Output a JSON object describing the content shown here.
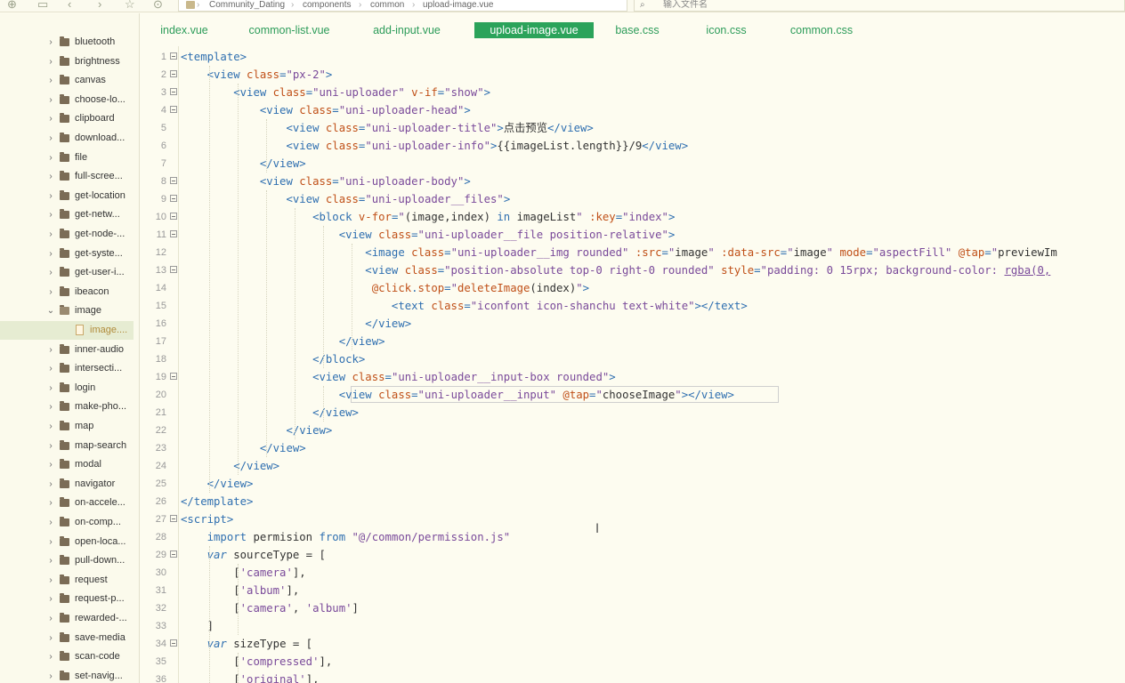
{
  "toolbar": {
    "icons": [
      "new-file-icon",
      "save-icon",
      "back-icon",
      "forward-icon",
      "star-icon",
      "run-icon"
    ],
    "breadcrumb": [
      "Community_Dating",
      "components",
      "common",
      "upload-image.vue"
    ],
    "search_placeholder": "输入文件名"
  },
  "sidebar": {
    "items": [
      {
        "label": "bluetooth",
        "type": "folder",
        "expanded": false
      },
      {
        "label": "brightness",
        "type": "folder",
        "expanded": false
      },
      {
        "label": "canvas",
        "type": "folder",
        "expanded": false
      },
      {
        "label": "choose-lo...",
        "type": "folder",
        "expanded": false
      },
      {
        "label": "clipboard",
        "type": "folder",
        "expanded": false
      },
      {
        "label": "download...",
        "type": "folder",
        "expanded": false
      },
      {
        "label": "file",
        "type": "folder",
        "expanded": false
      },
      {
        "label": "full-scree...",
        "type": "folder",
        "expanded": false
      },
      {
        "label": "get-location",
        "type": "folder",
        "expanded": false
      },
      {
        "label": "get-netw...",
        "type": "folder",
        "expanded": false
      },
      {
        "label": "get-node-...",
        "type": "folder",
        "expanded": false
      },
      {
        "label": "get-syste...",
        "type": "folder",
        "expanded": false
      },
      {
        "label": "get-user-i...",
        "type": "folder",
        "expanded": false
      },
      {
        "label": "ibeacon",
        "type": "folder",
        "expanded": false
      },
      {
        "label": "image",
        "type": "folder",
        "expanded": true
      },
      {
        "label": "image....",
        "type": "file",
        "selected": true
      },
      {
        "label": "inner-audio",
        "type": "folder",
        "expanded": false
      },
      {
        "label": "intersecti...",
        "type": "folder",
        "expanded": false
      },
      {
        "label": "login",
        "type": "folder",
        "expanded": false
      },
      {
        "label": "make-pho...",
        "type": "folder",
        "expanded": false
      },
      {
        "label": "map",
        "type": "folder",
        "expanded": false
      },
      {
        "label": "map-search",
        "type": "folder",
        "expanded": false
      },
      {
        "label": "modal",
        "type": "folder",
        "expanded": false
      },
      {
        "label": "navigator",
        "type": "folder",
        "expanded": false
      },
      {
        "label": "on-accele...",
        "type": "folder",
        "expanded": false
      },
      {
        "label": "on-comp...",
        "type": "folder",
        "expanded": false
      },
      {
        "label": "open-loca...",
        "type": "folder",
        "expanded": false
      },
      {
        "label": "pull-down...",
        "type": "folder",
        "expanded": false
      },
      {
        "label": "request",
        "type": "folder",
        "expanded": false
      },
      {
        "label": "request-p...",
        "type": "folder",
        "expanded": false
      },
      {
        "label": "rewarded-...",
        "type": "folder",
        "expanded": false
      },
      {
        "label": "save-media",
        "type": "folder",
        "expanded": false
      },
      {
        "label": "scan-code",
        "type": "folder",
        "expanded": false
      },
      {
        "label": "set-navig...",
        "type": "folder",
        "expanded": false
      }
    ]
  },
  "tabs": [
    {
      "label": "index.vue",
      "active": false
    },
    {
      "label": "common-list.vue",
      "active": false
    },
    {
      "label": "add-input.vue",
      "active": false
    },
    {
      "label": "upload-image.vue",
      "active": true
    },
    {
      "label": "base.css",
      "active": false
    },
    {
      "label": "icon.css",
      "active": false
    },
    {
      "label": "common.css",
      "active": false
    }
  ],
  "colors": {
    "tag": "#2f6fb0",
    "attr": "#c05018",
    "string": "#7a4a9a",
    "text": "#333333",
    "keyword": "#2f6fb0",
    "punct": "#2f6fb0",
    "accent": "#2ba35a"
  },
  "code_lines": [
    {
      "n": "1",
      "fold": true,
      "tokens": [
        [
          "tag",
          "<template>"
        ]
      ]
    },
    {
      "n": "2",
      "fold": true,
      "tokens": [
        [
          "text",
          "    "
        ],
        [
          "tag",
          "<view "
        ],
        [
          "attr",
          "class"
        ],
        [
          "punct",
          "="
        ],
        [
          "string",
          "\"px-2\""
        ],
        [
          "tag",
          ">"
        ]
      ]
    },
    {
      "n": "3",
      "fold": true,
      "tokens": [
        [
          "text",
          "        "
        ],
        [
          "tag",
          "<view "
        ],
        [
          "attr",
          "class"
        ],
        [
          "punct",
          "="
        ],
        [
          "string",
          "\"uni-uploader\" "
        ],
        [
          "attr",
          "v-if"
        ],
        [
          "punct",
          "="
        ],
        [
          "string",
          "\"show\""
        ],
        [
          "tag",
          ">"
        ]
      ]
    },
    {
      "n": "4",
      "fold": true,
      "tokens": [
        [
          "text",
          "            "
        ],
        [
          "tag",
          "<view "
        ],
        [
          "attr",
          "class"
        ],
        [
          "punct",
          "="
        ],
        [
          "string",
          "\"uni-uploader-head\""
        ],
        [
          "tag",
          ">"
        ]
      ]
    },
    {
      "n": "5",
      "fold": false,
      "tokens": [
        [
          "text",
          "                "
        ],
        [
          "tag",
          "<view "
        ],
        [
          "attr",
          "class"
        ],
        [
          "punct",
          "="
        ],
        [
          "string",
          "\"uni-uploader-title\""
        ],
        [
          "tag",
          ">"
        ],
        [
          "text",
          "点击预览"
        ],
        [
          "tag",
          "</view>"
        ]
      ]
    },
    {
      "n": "6",
      "fold": false,
      "tokens": [
        [
          "text",
          "                "
        ],
        [
          "tag",
          "<view "
        ],
        [
          "attr",
          "class"
        ],
        [
          "punct",
          "="
        ],
        [
          "string",
          "\"uni-uploader-info\""
        ],
        [
          "tag",
          ">"
        ],
        [
          "text",
          "{{imageList.length}}/9"
        ],
        [
          "tag",
          "</view>"
        ]
      ]
    },
    {
      "n": "7",
      "fold": false,
      "tokens": [
        [
          "text",
          "            "
        ],
        [
          "tag",
          "</view>"
        ]
      ]
    },
    {
      "n": "8",
      "fold": true,
      "tokens": [
        [
          "text",
          "            "
        ],
        [
          "tag",
          "<view "
        ],
        [
          "attr",
          "class"
        ],
        [
          "punct",
          "="
        ],
        [
          "string",
          "\"uni-uploader-body\""
        ],
        [
          "tag",
          ">"
        ]
      ]
    },
    {
      "n": "9",
      "fold": true,
      "tokens": [
        [
          "text",
          "                "
        ],
        [
          "tag",
          "<view "
        ],
        [
          "attr",
          "class"
        ],
        [
          "punct",
          "="
        ],
        [
          "string",
          "\"uni-uploader__files\""
        ],
        [
          "tag",
          ">"
        ]
      ]
    },
    {
      "n": "10",
      "fold": true,
      "tokens": [
        [
          "text",
          "                    "
        ],
        [
          "tag",
          "<block "
        ],
        [
          "attr",
          "v-for"
        ],
        [
          "punct",
          "="
        ],
        [
          "string",
          "\""
        ],
        [
          "text",
          "(image,index) "
        ],
        [
          "tag",
          "in "
        ],
        [
          "text",
          "imageList"
        ],
        [
          "string",
          "\" "
        ],
        [
          "attr",
          ":key"
        ],
        [
          "punct",
          "="
        ],
        [
          "string",
          "\"index\""
        ],
        [
          "tag",
          ">"
        ]
      ]
    },
    {
      "n": "11",
      "fold": true,
      "tokens": [
        [
          "text",
          "                        "
        ],
        [
          "tag",
          "<view "
        ],
        [
          "attr",
          "class"
        ],
        [
          "punct",
          "="
        ],
        [
          "string",
          "\"uni-uploader__file position-relative\""
        ],
        [
          "tag",
          ">"
        ]
      ]
    },
    {
      "n": "12",
      "fold": false,
      "tokens": [
        [
          "text",
          "                            "
        ],
        [
          "tag",
          "<image "
        ],
        [
          "attr",
          "class"
        ],
        [
          "punct",
          "="
        ],
        [
          "string",
          "\"uni-uploader__img rounded\" "
        ],
        [
          "attr",
          ":src"
        ],
        [
          "punct",
          "="
        ],
        [
          "string",
          "\""
        ],
        [
          "text",
          "image"
        ],
        [
          "string",
          "\" "
        ],
        [
          "attr",
          ":data-src"
        ],
        [
          "punct",
          "="
        ],
        [
          "string",
          "\""
        ],
        [
          "text",
          "image"
        ],
        [
          "string",
          "\" "
        ],
        [
          "attr",
          "mode"
        ],
        [
          "punct",
          "="
        ],
        [
          "string",
          "\"aspectFill\" "
        ],
        [
          "attr",
          "@tap"
        ],
        [
          "punct",
          "="
        ],
        [
          "string",
          "\""
        ],
        [
          "text",
          "previewIm"
        ]
      ]
    },
    {
      "n": "13",
      "fold": true,
      "tokens": [
        [
          "text",
          "                            "
        ],
        [
          "tag",
          "<view "
        ],
        [
          "attr",
          "class"
        ],
        [
          "punct",
          "="
        ],
        [
          "string",
          "\"position-absolute top-0 right-0 rounded\" "
        ],
        [
          "attr",
          "style"
        ],
        [
          "punct",
          "="
        ],
        [
          "string",
          "\"padding: 0 15rpx; background-color: "
        ],
        [
          "ul",
          "rgba(0,"
        ]
      ]
    },
    {
      "n": "14",
      "fold": false,
      "tokens": [
        [
          "text",
          "                             "
        ],
        [
          "attr",
          "@click"
        ],
        [
          "punct",
          "."
        ],
        [
          "attr",
          "stop"
        ],
        [
          "punct",
          "="
        ],
        [
          "string",
          "\""
        ],
        [
          "attr",
          "deleteImage"
        ],
        [
          "text",
          "(index)"
        ],
        [
          "string",
          "\""
        ],
        [
          "tag",
          ">"
        ]
      ]
    },
    {
      "n": "15",
      "fold": false,
      "tokens": [
        [
          "text",
          "                                "
        ],
        [
          "tag",
          "<text "
        ],
        [
          "attr",
          "class"
        ],
        [
          "punct",
          "="
        ],
        [
          "string",
          "\"iconfont icon-shanchu text-white\""
        ],
        [
          "tag",
          "></text>"
        ]
      ]
    },
    {
      "n": "16",
      "fold": false,
      "tokens": [
        [
          "text",
          "                            "
        ],
        [
          "tag",
          "</view>"
        ]
      ]
    },
    {
      "n": "17",
      "fold": false,
      "tokens": [
        [
          "text",
          "                        "
        ],
        [
          "tag",
          "</view>"
        ]
      ]
    },
    {
      "n": "18",
      "fold": false,
      "tokens": [
        [
          "text",
          "                    "
        ],
        [
          "tag",
          "</block>"
        ]
      ]
    },
    {
      "n": "19",
      "fold": true,
      "tokens": [
        [
          "text",
          "                    "
        ],
        [
          "tag",
          "<view "
        ],
        [
          "attr",
          "class"
        ],
        [
          "punct",
          "="
        ],
        [
          "string",
          "\"uni-uploader__input-box rounded\""
        ],
        [
          "tag",
          ">"
        ]
      ]
    },
    {
      "n": "20",
      "fold": false,
      "tokens": [
        [
          "text",
          "                        "
        ],
        [
          "tag",
          "<view "
        ],
        [
          "attr",
          "class"
        ],
        [
          "punct",
          "="
        ],
        [
          "string",
          "\"uni-uploader__input\" "
        ],
        [
          "attr",
          "@tap"
        ],
        [
          "punct",
          "="
        ],
        [
          "string",
          "\""
        ],
        [
          "text",
          "chooseImage"
        ],
        [
          "string",
          "\""
        ],
        [
          "tag",
          "></view>"
        ]
      ]
    },
    {
      "n": "21",
      "fold": false,
      "tokens": [
        [
          "text",
          "                    "
        ],
        [
          "tag",
          "</view>"
        ]
      ]
    },
    {
      "n": "22",
      "fold": false,
      "tokens": [
        [
          "text",
          "                "
        ],
        [
          "tag",
          "</view>"
        ]
      ]
    },
    {
      "n": "23",
      "fold": false,
      "tokens": [
        [
          "text",
          "            "
        ],
        [
          "tag",
          "</view>"
        ]
      ]
    },
    {
      "n": "24",
      "fold": false,
      "tokens": [
        [
          "text",
          "        "
        ],
        [
          "tag",
          "</view>"
        ]
      ]
    },
    {
      "n": "25",
      "fold": false,
      "tokens": [
        [
          "text",
          "    "
        ],
        [
          "tag",
          "</view>"
        ]
      ]
    },
    {
      "n": "26",
      "fold": false,
      "tokens": [
        [
          "tag",
          "</template>"
        ]
      ]
    },
    {
      "n": "27",
      "fold": true,
      "tokens": [
        [
          "tag",
          "<script>"
        ]
      ]
    },
    {
      "n": "28",
      "fold": false,
      "tokens": [
        [
          "text",
          "    "
        ],
        [
          "keyword",
          "import "
        ],
        [
          "text",
          "permision "
        ],
        [
          "keyword",
          "from "
        ],
        [
          "string",
          "\"@/common/permission.js\""
        ]
      ]
    },
    {
      "n": "29",
      "fold": true,
      "tokens": [
        [
          "text",
          "    "
        ],
        [
          "kwi",
          "var "
        ],
        [
          "text",
          "sourceType = ["
        ]
      ]
    },
    {
      "n": "30",
      "fold": false,
      "tokens": [
        [
          "text",
          "        ["
        ],
        [
          "string",
          "'camera'"
        ],
        [
          "text",
          "],"
        ]
      ]
    },
    {
      "n": "31",
      "fold": false,
      "tokens": [
        [
          "text",
          "        ["
        ],
        [
          "string",
          "'album'"
        ],
        [
          "text",
          "],"
        ]
      ]
    },
    {
      "n": "32",
      "fold": false,
      "tokens": [
        [
          "text",
          "        ["
        ],
        [
          "string",
          "'camera'"
        ],
        [
          "text",
          ", "
        ],
        [
          "string",
          "'album'"
        ],
        [
          "text",
          "]"
        ]
      ]
    },
    {
      "n": "33",
      "fold": false,
      "tokens": [
        [
          "text",
          "    ]"
        ]
      ]
    },
    {
      "n": "34",
      "fold": true,
      "tokens": [
        [
          "text",
          "    "
        ],
        [
          "kwi",
          "var "
        ],
        [
          "text",
          "sizeType = ["
        ]
      ]
    },
    {
      "n": "35",
      "fold": false,
      "tokens": [
        [
          "text",
          "        ["
        ],
        [
          "string",
          "'compressed'"
        ],
        [
          "text",
          "],"
        ]
      ]
    },
    {
      "n": "36",
      "fold": false,
      "tokens": [
        [
          "text",
          "        ["
        ],
        [
          "string",
          "'original'"
        ],
        [
          "text",
          "],"
        ]
      ]
    }
  ]
}
